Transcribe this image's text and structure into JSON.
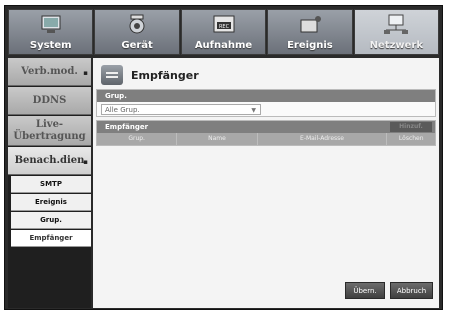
{
  "tabs": [
    {
      "label": "System",
      "icon": "system-icon"
    },
    {
      "label": "Gerät",
      "icon": "camera-icon"
    },
    {
      "label": "Aufnahme",
      "icon": "rec-icon",
      "badge": "REC"
    },
    {
      "label": "Ereignis",
      "icon": "event-icon"
    },
    {
      "label": "Netzwerk",
      "icon": "network-icon"
    }
  ],
  "sidebar": {
    "items": [
      {
        "label": "Verb.mod."
      },
      {
        "label": "DDNS"
      },
      {
        "label": "Live-\nÜbertragung"
      },
      {
        "label": "Benach.dien"
      }
    ],
    "subitems": [
      "SMTP",
      "Ereignis",
      "Grup.",
      "Empfänger"
    ]
  },
  "page": {
    "title": "Empfänger",
    "group_header": "Grup.",
    "group_select": "Alle Grup.",
    "recipients_header": "Empfänger",
    "add_button": "Hinzuf.",
    "columns": [
      "Grup.",
      "Name",
      "E-Mail-Adresse",
      "Löschen"
    ],
    "ok_button": "Übern.",
    "cancel_button": "Abbruch"
  },
  "colors": {
    "accent": "#7f7f7f",
    "active_tab": "#cfd3d8"
  }
}
